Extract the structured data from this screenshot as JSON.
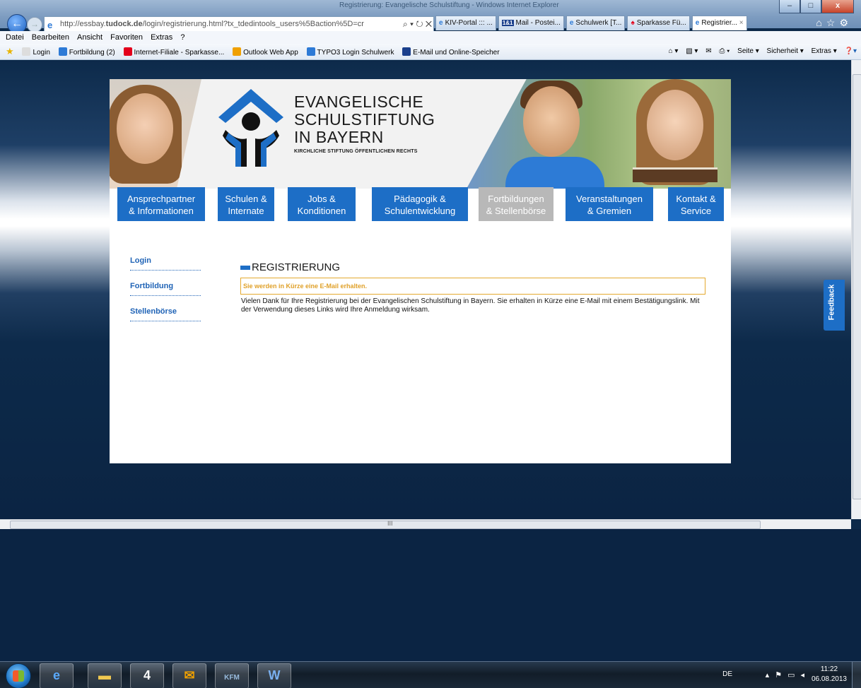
{
  "window": {
    "title": "Registrierung: Evangelische Schulstiftung - Windows Internet Explorer"
  },
  "addressbar": {
    "url_prefix": "http://essbay.",
    "url_domain": "tudock.de",
    "url_rest": "/login/registrierung.html?tx_tdedintools_users%5Baction%5D=cr",
    "tools": "⌕ ▾ ↻ ✕"
  },
  "tabs": [
    {
      "label": "KIV-Portal ::: ...",
      "icon": "ie-icon"
    },
    {
      "label": "Mail - Postei...",
      "icon": "mail-icon"
    },
    {
      "label": "Schulwerk [T...",
      "icon": "ie-icon"
    },
    {
      "label": "Sparkasse Fü...",
      "icon": "sparkasse-icon"
    },
    {
      "label": "Registrier...",
      "icon": "ie-icon",
      "active": true
    }
  ],
  "menubar": [
    "Datei",
    "Bearbeiten",
    "Ansicht",
    "Favoriten",
    "Extras",
    "?"
  ],
  "favorites": [
    {
      "label": "Login",
      "icon": "web-icon"
    },
    {
      "label": "Fortbildung (2)",
      "icon": "ie-icon"
    },
    {
      "label": "Internet-Filiale - Sparkasse...",
      "icon": "sparkasse-icon"
    },
    {
      "label": "Outlook Web App",
      "icon": "outlook-icon"
    },
    {
      "label": "TYPO3 Login Schulwerk",
      "icon": "ie-icon"
    },
    {
      "label": "E-Mail und Online-Speicher",
      "icon": "mail-icon"
    }
  ],
  "favtools": [
    "Seite ▾",
    "Sicherheit ▾",
    "Extras ▾"
  ],
  "site": {
    "brand": [
      "EVANGELISCHE",
      "SCHULSTIFTUNG",
      "IN BAYERN"
    ],
    "brand_sub": "KIRCHLICHE STIFTUNG ÖFFENTLICHEN RECHTS",
    "nav": [
      {
        "line1": "Ansprechpartner",
        "line2": "& Informationen"
      },
      {
        "line1": "Schulen &",
        "line2": "Internate"
      },
      {
        "line1": "Jobs &",
        "line2": "Konditionen"
      },
      {
        "line1": "Pädagogik &",
        "line2": "Schulentwicklung"
      },
      {
        "line1": "Fortbildungen",
        "line2": "& Stellenbörse",
        "active": true
      },
      {
        "line1": "Veranstaltungen",
        "line2": "& Gremien"
      },
      {
        "line1": "Kontakt &",
        "line2": "Service"
      }
    ],
    "sidebar": [
      "Login",
      "Fortbildung",
      "Stellenbörse"
    ],
    "content": {
      "title": "REGISTRIERUNG",
      "notice": "Sie werden in Kürze eine E-Mail erhalten.",
      "body": "Vielen Dank für Ihre Registrierung bei der Evangelischen Schulstiftung in Bayern. Sie erhalten in Kürze eine E-Mail mit einem Bestätigungslink. Mit der Verwendung dieses Links wird Ihre Anmeldung wirksam."
    },
    "feedback": "Feedback"
  },
  "scrollbar": {
    "center_mark": "III"
  },
  "taskbar": {
    "apps": [
      "ie",
      "explorer",
      "4",
      "outlook",
      "KFM",
      "word"
    ],
    "lang": "DE",
    "time": "11:22",
    "date": "06.08.2013"
  },
  "colors": {
    "accent": "#1d6ec6",
    "notice": "#e0a12a",
    "nav_active": "#b8b8b8",
    "page_bg": "#0d2a4a"
  }
}
